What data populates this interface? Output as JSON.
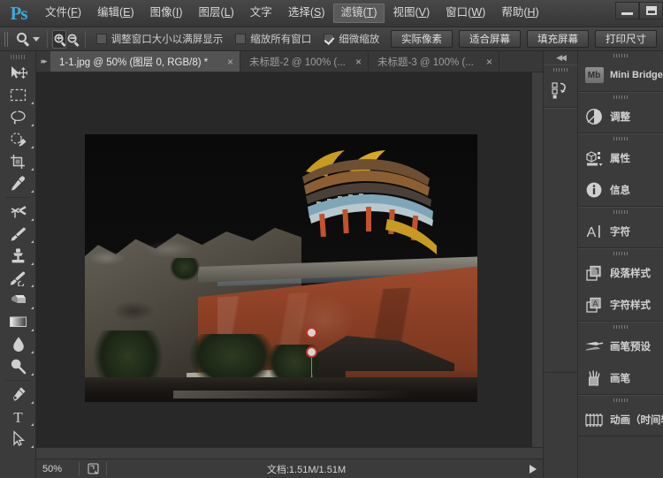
{
  "app": {
    "logo": "Ps",
    "menu": [
      {
        "label": "文件(F)",
        "active": false
      },
      {
        "label": "编辑(E)",
        "active": false
      },
      {
        "label": "图像(I)",
        "active": false
      },
      {
        "label": "图层(L)",
        "active": false
      },
      {
        "label": "文字",
        "active": false
      },
      {
        "label": "选择(S)",
        "active": false
      },
      {
        "label": "滤镜(T)",
        "active": true
      },
      {
        "label": "视图(V)",
        "active": false
      },
      {
        "label": "窗口(W)",
        "active": false
      },
      {
        "label": "帮助(H)",
        "active": false
      }
    ],
    "window_controls": [
      {
        "name": "minimize"
      },
      {
        "name": "maximize"
      }
    ]
  },
  "options_bar": {
    "current_tool": "zoom-tool",
    "zoom_in_selected": true,
    "zoom_out_selected": false,
    "checkboxes": [
      {
        "label": "调整窗口大小以满屏显示",
        "checked": false
      },
      {
        "label": "缩放所有窗口",
        "checked": false
      },
      {
        "label": "细微缩放",
        "checked": true
      }
    ],
    "buttons": [
      {
        "label": "实际像素"
      },
      {
        "label": "适合屏幕"
      },
      {
        "label": "填充屏幕"
      },
      {
        "label": "打印尺寸"
      }
    ]
  },
  "tabs": [
    {
      "label": "1-1.jpg @ 50% (图层 0, RGB/8) *",
      "active": true,
      "close": "×"
    },
    {
      "label": "未标题-2 @ 100% (...",
      "active": false,
      "close": "×"
    },
    {
      "label": "未标题-3 @ 100% (...",
      "active": false,
      "close": "×"
    }
  ],
  "toolbar": {
    "tools": [
      {
        "name": "move-tool",
        "has_submenu": false
      },
      {
        "name": "rectangular-marquee-tool",
        "has_submenu": true
      },
      {
        "name": "lasso-tool",
        "has_submenu": true
      },
      {
        "name": "quick-selection-tool",
        "has_submenu": true
      },
      {
        "name": "crop-tool",
        "has_submenu": true
      },
      {
        "name": "eyedropper-tool",
        "has_submenu": true
      },
      {
        "name": "spot-healing-brush-tool",
        "has_submenu": true
      },
      {
        "name": "brush-tool",
        "has_submenu": true
      },
      {
        "name": "clone-stamp-tool",
        "has_submenu": true
      },
      {
        "name": "history-brush-tool",
        "has_submenu": true
      },
      {
        "name": "eraser-tool",
        "has_submenu": true
      },
      {
        "name": "gradient-tool",
        "has_submenu": true
      },
      {
        "name": "blur-tool",
        "has_submenu": true
      },
      {
        "name": "dodge-tool",
        "has_submenu": true
      },
      {
        "name": "pen-tool",
        "has_submenu": true
      },
      {
        "name": "horizontal-type-tool",
        "has_submenu": true
      },
      {
        "name": "path-selection-tool",
        "has_submenu": true
      }
    ]
  },
  "canvas": {
    "image_title": "1-1.jpg",
    "subject": "night photograph of Chinese imperial palace gate tower with red wall",
    "zoom": "50%"
  },
  "status_bar": {
    "zoom": "50%",
    "doc_info": "文档:1.51M/1.51M",
    "play_arrow": "▶"
  },
  "dock": {
    "collapse_arrows": "◀◀",
    "groups": [
      {
        "items": [
          {
            "label": "Mini Bridge",
            "icon": "mini-bridge-icon",
            "badge": "Mb"
          }
        ]
      },
      {
        "items": [
          {
            "label": "调整",
            "icon": "adjustments-icon"
          }
        ]
      },
      {
        "items": [
          {
            "label": "属性",
            "icon": "properties-icon"
          },
          {
            "label": "信息",
            "icon": "info-icon"
          }
        ]
      },
      {
        "items": [
          {
            "label": "字符",
            "icon": "character-icon"
          }
        ]
      },
      {
        "items": [
          {
            "label": "段落样式",
            "icon": "paragraph-styles-icon"
          },
          {
            "label": "字符样式",
            "icon": "character-styles-icon"
          }
        ]
      },
      {
        "items": [
          {
            "label": "画笔预设",
            "icon": "brush-presets-icon"
          },
          {
            "label": "画笔",
            "icon": "brush-icon"
          }
        ]
      },
      {
        "items": [
          {
            "label": "动画（时间轴",
            "icon": "animation-timeline-icon"
          }
        ]
      }
    ]
  },
  "colors": {
    "chrome": "#3b3b3b",
    "canvas_bg": "#282828",
    "accent": "#3fa9d8",
    "active_tab": "#535353"
  }
}
